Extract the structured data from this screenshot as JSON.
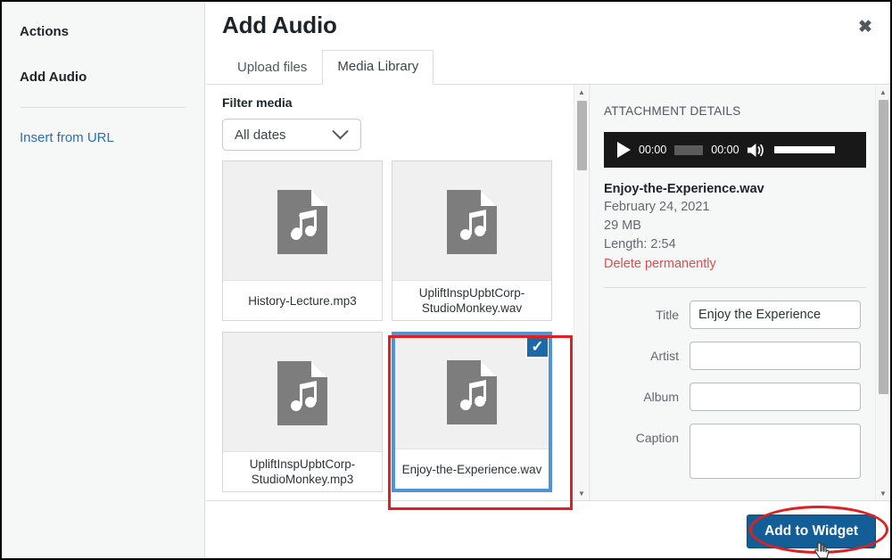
{
  "sidebar": {
    "heading_actions": "Actions",
    "heading_add_audio": "Add Audio",
    "insert_from_url": "Insert from URL"
  },
  "modal": {
    "title": "Add Audio",
    "close_icon": "close-icon",
    "tabs": [
      {
        "label": "Upload files",
        "active": false
      },
      {
        "label": "Media Library",
        "active": true
      }
    ]
  },
  "browser": {
    "filter_label": "Filter media",
    "date_filter": {
      "value": "All dates",
      "icon": "chevron-down-icon"
    },
    "items": [
      {
        "filename": "History-Lecture.mp3",
        "selected": false,
        "icon": "audio-file-icon"
      },
      {
        "filename": "UpliftInspUpbtCorp-StudioMonkey.wav",
        "selected": false,
        "icon": "audio-file-icon"
      },
      {
        "filename": "UpliftInspUpbtCorp-StudioMonkey.mp3",
        "selected": false,
        "icon": "audio-file-icon"
      },
      {
        "filename": "Enjoy-the-Experience.wav",
        "selected": true,
        "icon": "audio-file-icon",
        "check_icon": "checkmark-icon"
      }
    ]
  },
  "details": {
    "heading": "ATTACHMENT DETAILS",
    "player": {
      "play_icon": "play-icon",
      "current_time": "00:00",
      "duration": "00:00",
      "volume_icon": "volume-icon"
    },
    "filename": "Enjoy-the-Experience.wav",
    "date": "February 24, 2021",
    "filesize": "29 MB",
    "length": "Length: 2:54",
    "delete_label": "Delete permanently",
    "fields": [
      {
        "label": "Title",
        "value": "Enjoy the Experience",
        "type": "input"
      },
      {
        "label": "Artist",
        "value": "",
        "type": "input"
      },
      {
        "label": "Album",
        "value": "",
        "type": "input"
      },
      {
        "label": "Caption",
        "value": "",
        "type": "textarea"
      }
    ]
  },
  "footer": {
    "add_button": "Add to Widget"
  },
  "colors": {
    "accent_blue": "#135e96",
    "selection_blue": "#4f94d4",
    "check_blue": "#1a6aa8",
    "annotation_red": "#e02020",
    "link_blue": "#2a6fb5",
    "delete_red": "#d94f4f"
  }
}
